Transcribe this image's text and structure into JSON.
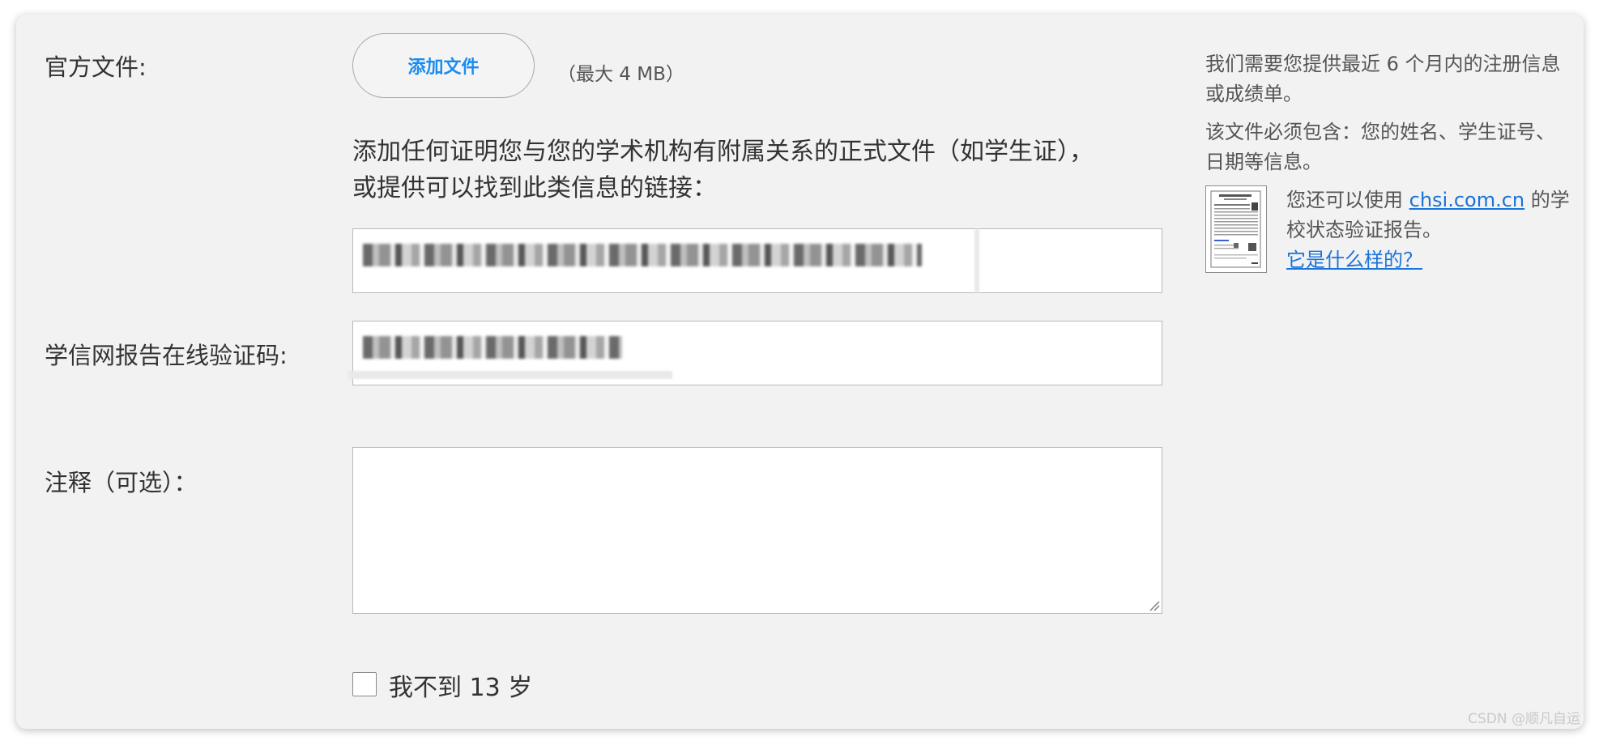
{
  "labels": {
    "official_document": "官方文件:",
    "verification_code": "学信网报告在线验证码:",
    "notes": "注释（可选）："
  },
  "upload": {
    "button_label": "添加文件",
    "max_size": "（最大 4 MB）",
    "description": "添加任何证明您与您的学术机构有附属关系的正式文件（如学生证），或提供可以找到此类信息的链接："
  },
  "age_check": {
    "label": "我不到 13 岁",
    "checked": false
  },
  "sidebar": {
    "info_1": "我们需要您提供最近 6 个月内的注册信息或成绩单。",
    "info_2": "该文件必须包含：您的姓名、学生证号、日期等信息。",
    "chsi_prefix": "您还可以使用 ",
    "chsi_link": "chsi.com.cn",
    "chsi_suffix": " 的学校状态验证报告。",
    "example_link": "它是什么样的？"
  },
  "watermark": "CSDN @顺凡自运",
  "colors": {
    "panel_bg": "#f2f2f2",
    "accent": "#1a8cf0",
    "link": "#1a73d9"
  }
}
